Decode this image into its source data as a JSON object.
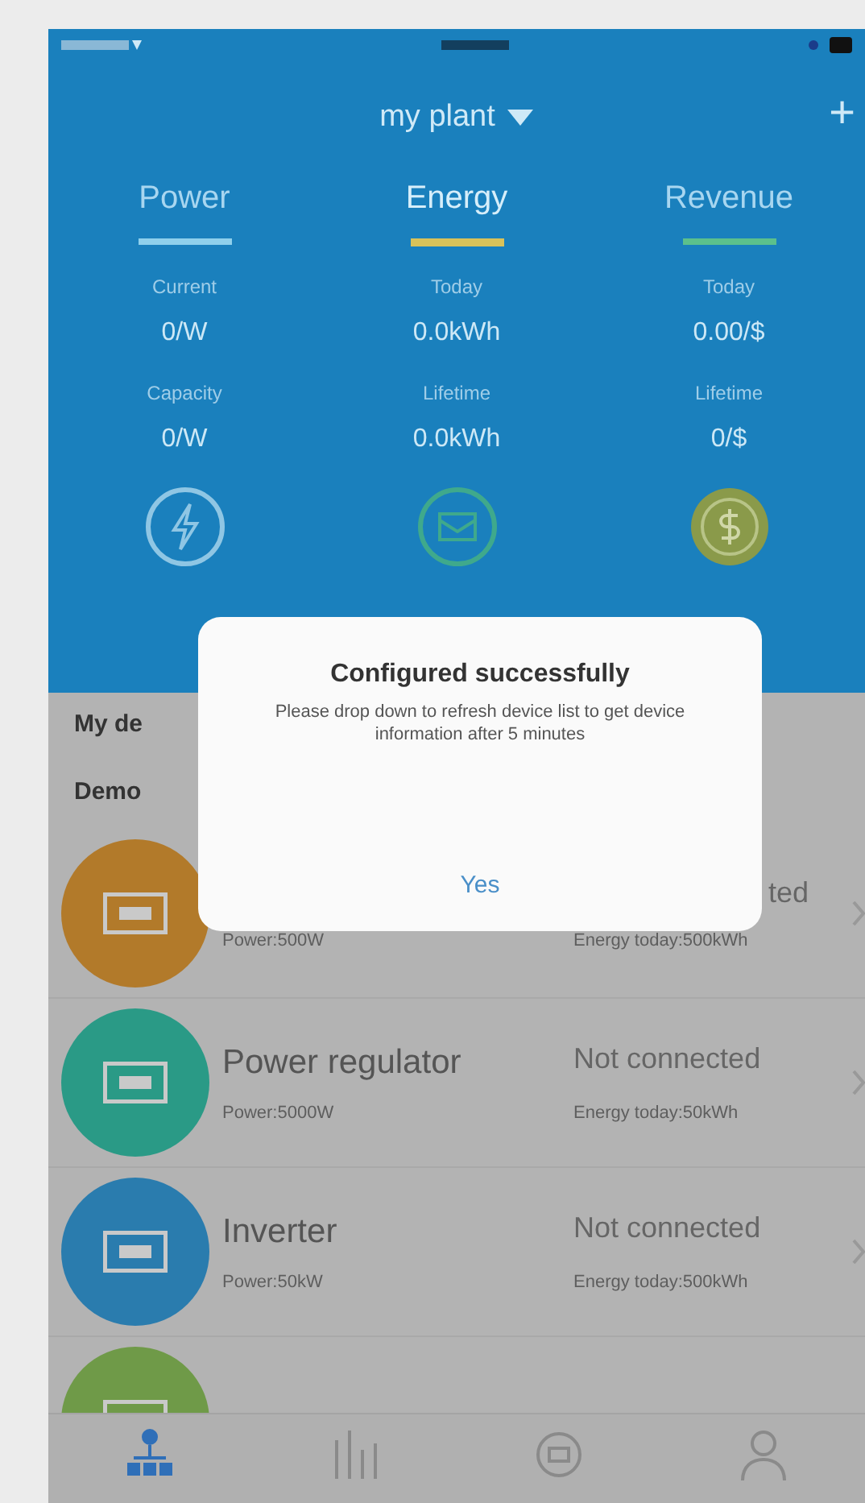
{
  "header": {
    "title": "my plant",
    "add_symbol": "+"
  },
  "tabs": [
    {
      "label": "Power",
      "color": "#8fd0ec",
      "selected": false
    },
    {
      "label": "Energy",
      "color": "#d9c25a",
      "selected": true
    },
    {
      "label": "Revenue",
      "color": "#5cc08c",
      "selected": false
    }
  ],
  "stats": [
    [
      {
        "label": "Current",
        "value": "0/W"
      },
      {
        "label": "Today",
        "value": "0.0kWh"
      },
      {
        "label": "Today",
        "value": "0.00/$"
      }
    ],
    [
      {
        "label": "Capacity",
        "value": "0/W"
      },
      {
        "label": "Lifetime",
        "value": "0.0kWh"
      },
      {
        "label": "Lifetime",
        "value": "0/$"
      }
    ]
  ],
  "section_title": "My de",
  "group_title": "Demo",
  "devices": [
    {
      "color": "#b27a2a",
      "status": "ted",
      "status_covered": true,
      "power": "Power:500W",
      "energy": "Energy today:500kWh"
    },
    {
      "color": "#2a9a86",
      "name": "Power regulator",
      "status": "Not connected",
      "power": "Power:5000W",
      "energy": "Energy today:50kWh"
    },
    {
      "color": "#2a7cae",
      "name": "Inverter",
      "status": "Not connected",
      "power": "Power:50kW",
      "energy": "Energy today:500kWh"
    },
    {
      "color": "#6f9a48"
    }
  ],
  "tabbar": [
    {
      "kind": "plant",
      "selected": true
    },
    {
      "kind": "chart",
      "selected": false
    },
    {
      "kind": "device",
      "selected": false
    },
    {
      "kind": "user",
      "selected": false
    }
  ],
  "dialog": {
    "title": "Configured successfully",
    "message": "Please drop down  to refresh device list to get device information after 5 minutes",
    "button": "Yes"
  }
}
